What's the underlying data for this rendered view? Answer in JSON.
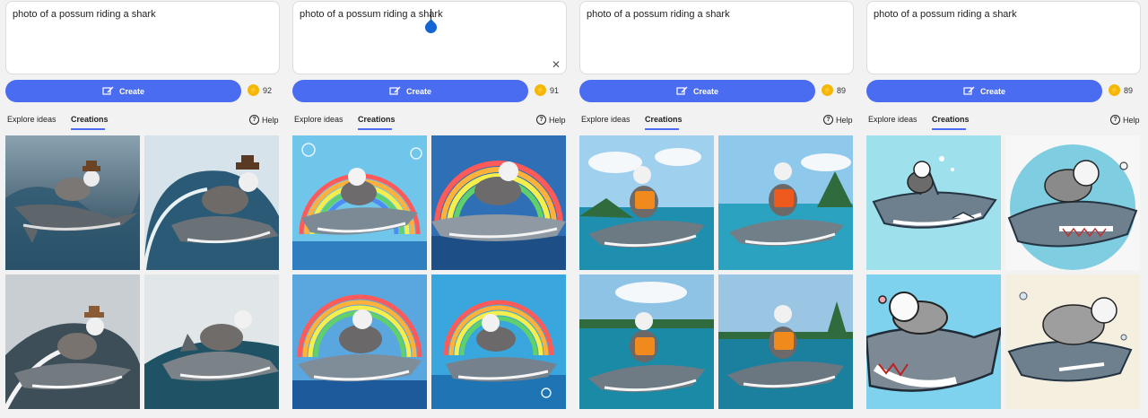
{
  "panels": [
    {
      "prompt": "photo of a possum riding a shark",
      "create_label": "Create",
      "boosts": "92",
      "tabs": {
        "explore": "Explore ideas",
        "creations": "Creations"
      },
      "help": "Help",
      "images": [
        {
          "name": "possum-shark-cowboy-wave-1"
        },
        {
          "name": "possum-shark-cowboy-wave-2"
        },
        {
          "name": "possum-shark-cowboy-wave-3"
        },
        {
          "name": "possum-shark-cowboy-wave-4"
        }
      ]
    },
    {
      "prompt": "photo of a possum riding a shark",
      "create_label": "Create",
      "boosts": "91",
      "tabs": {
        "explore": "Explore ideas",
        "creations": "Creations"
      },
      "help": "Help",
      "images": [
        {
          "name": "possum-shark-rainbow-1"
        },
        {
          "name": "possum-shark-rainbow-2"
        },
        {
          "name": "possum-shark-rainbow-3"
        },
        {
          "name": "possum-shark-rainbow-4"
        }
      ]
    },
    {
      "prompt": "photo of a possum riding a shark",
      "create_label": "Create",
      "boosts": "89",
      "tabs": {
        "explore": "Explore ideas",
        "creations": "Creations"
      },
      "help": "Help",
      "images": [
        {
          "name": "possum-shark-lifejacket-island-1"
        },
        {
          "name": "possum-shark-lifejacket-island-2"
        },
        {
          "name": "possum-shark-lifejacket-island-3"
        },
        {
          "name": "possum-shark-lifejacket-island-4"
        }
      ]
    },
    {
      "prompt": "photo of a possum riding a shark",
      "create_label": "Create",
      "boosts": "89",
      "tabs": {
        "explore": "Explore ideas",
        "creations": "Creations"
      },
      "help": "Help",
      "images": [
        {
          "name": "possum-shark-cartoon-1"
        },
        {
          "name": "possum-shark-cartoon-2"
        },
        {
          "name": "possum-shark-cartoon-3"
        },
        {
          "name": "possum-shark-cartoon-4"
        }
      ]
    }
  ],
  "colors": {
    "accent": "#4a6cf0",
    "boost": "#f5b60a",
    "background": "#f2f2f2"
  },
  "icons": [
    "create-icon",
    "boost-icon",
    "help-icon",
    "clear-icon"
  ]
}
